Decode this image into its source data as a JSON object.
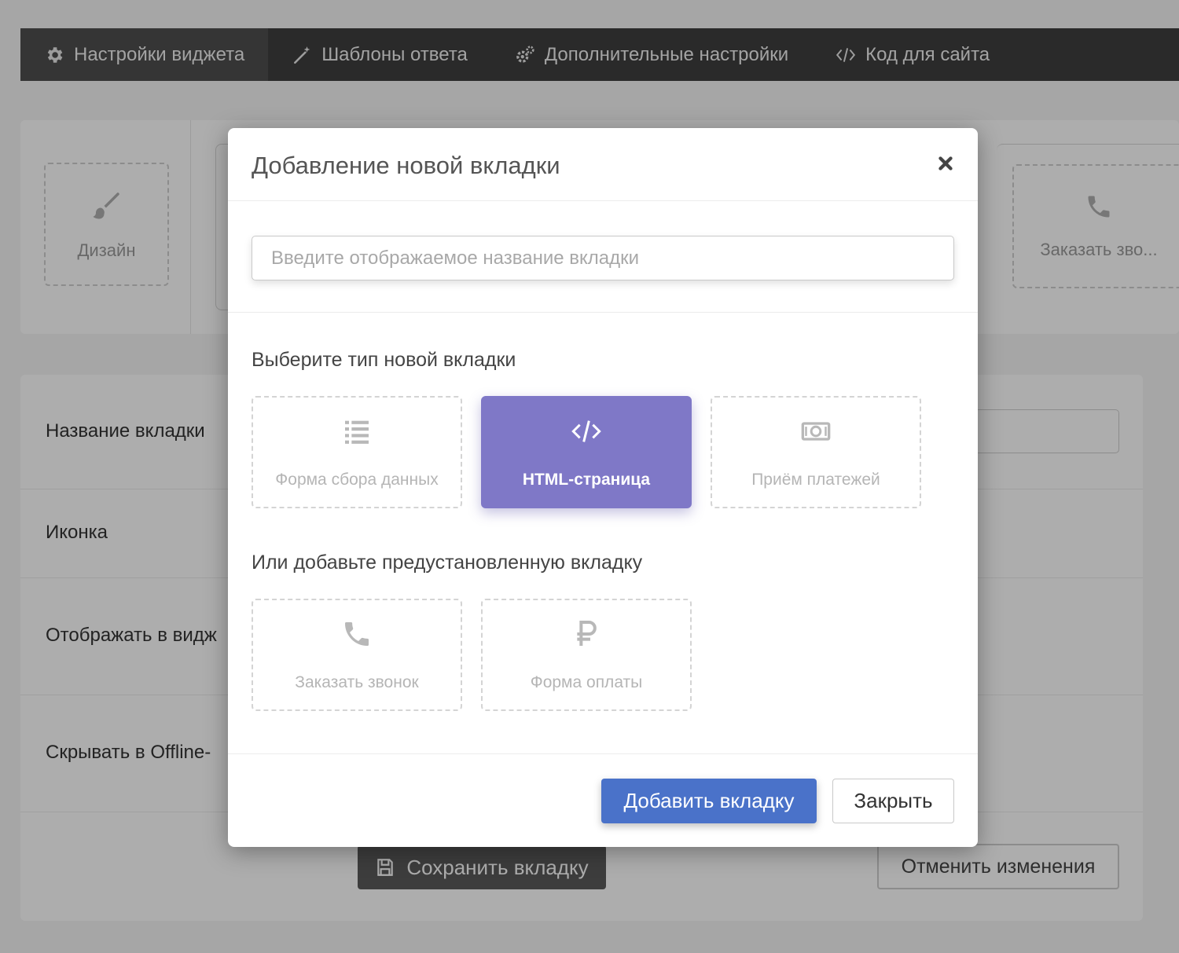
{
  "topnav": {
    "tabs": [
      {
        "label": "Настройки виджета",
        "icon": "gear-icon"
      },
      {
        "label": "Шаблоны ответа",
        "icon": "magic-wand-icon"
      },
      {
        "label": "Дополнительные настройки",
        "icon": "gears-icon"
      },
      {
        "label": "Код для сайта",
        "icon": "code-icon"
      }
    ]
  },
  "widget_tabs": {
    "design": {
      "label": "Дизайн",
      "icon": "paintbrush-icon"
    },
    "callback": {
      "label": "Заказать зво...",
      "icon": "phone-icon"
    }
  },
  "settings_form": {
    "rows": [
      {
        "label": "Название вкладки"
      },
      {
        "label": "Иконка"
      },
      {
        "label": "Отображать в видж"
      },
      {
        "label": "Скрывать в Offline-"
      }
    ],
    "save_label": "Сохранить вкладку",
    "cancel_label": "Отменить изменения"
  },
  "modal": {
    "title": "Добавление новой вкладки",
    "name_placeholder": "Введите отображаемое название вкладки",
    "type_section_title": "Выберите тип новой вкладки",
    "types": [
      {
        "label": "Форма сбора данных",
        "icon": "list-icon",
        "selected": false
      },
      {
        "label": "HTML-страница",
        "icon": "code-icon",
        "selected": true
      },
      {
        "label": "Приём платежей",
        "icon": "money-icon",
        "selected": false
      }
    ],
    "preset_section_title": "Или добавьте предустановленную вкладку",
    "presets": [
      {
        "label": "Заказать звонок",
        "icon": "phone-icon"
      },
      {
        "label": "Форма оплаты",
        "icon": "ruble-icon"
      }
    ],
    "add_label": "Добавить вкладку",
    "close_label": "Закрыть"
  },
  "colors": {
    "accent_selected": "#7f78c7",
    "primary_button": "#4a72c9",
    "topnav_bg": "#3e3e3e"
  }
}
